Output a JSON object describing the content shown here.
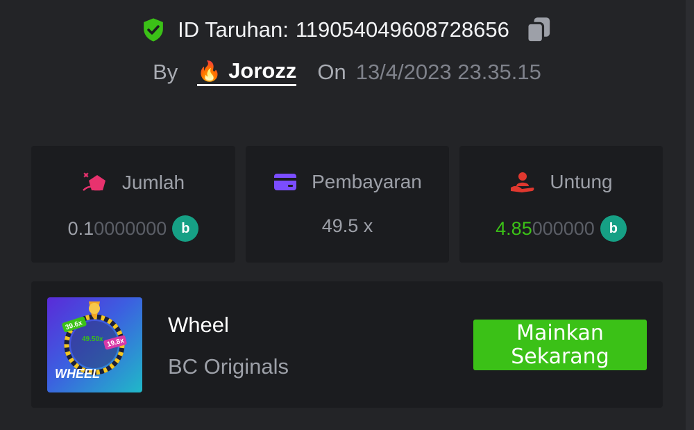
{
  "header": {
    "bet_id_label": "ID Taruhan:",
    "bet_id_value": "119054049608728656",
    "by_label": "By",
    "user_emoji": "🔥",
    "username": "Jorozz",
    "on_label": "On",
    "date": "13/4/2023 23.35.15"
  },
  "stats": {
    "amount": {
      "label": "Jumlah",
      "value_main": "0.1",
      "value_dim": "0000000",
      "icon": "hand-bag-icon",
      "coin": "bc-coin"
    },
    "payout": {
      "label": "Pembayaran",
      "value": "49.5 x",
      "icon": "card-icon"
    },
    "profit": {
      "label": "Untung",
      "value_main": "4.85",
      "value_dim": "000000",
      "icon": "hand-user-icon",
      "coin": "bc-coin"
    }
  },
  "game": {
    "title": "Wheel",
    "provider": "BC Originals",
    "thumb_label": "WHEEL",
    "thumb_badge_1": "39.6x",
    "thumb_badge_2": "49.50x",
    "thumb_badge_3": "19.8x",
    "play_label_line1": "Mainkan",
    "play_label_line2": "Sekarang"
  },
  "colors": {
    "background": "#232427",
    "card": "#1b1c1f",
    "accent_green": "#3bc117",
    "shield": "#3bc117",
    "amount_icon": "#e8326e",
    "payout_icon": "#7b4dff",
    "profit_icon": "#e0382f",
    "coin": "#16a085"
  }
}
